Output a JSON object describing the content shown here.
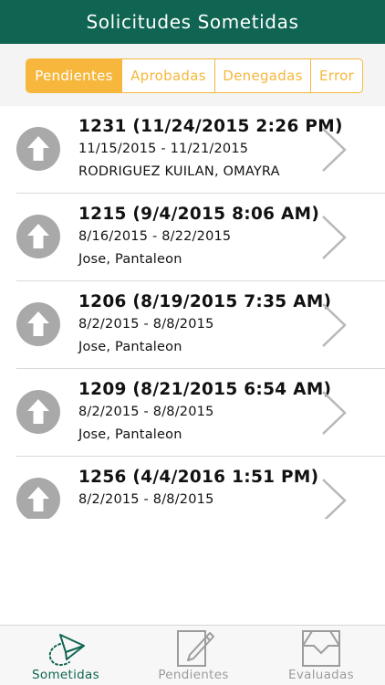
{
  "header": {
    "title": "Solicitudes Sometidas"
  },
  "segments": [
    {
      "label": "Pendientes",
      "active": true
    },
    {
      "label": "Aprobadas",
      "active": false
    },
    {
      "label": "Denegadas",
      "active": false
    },
    {
      "label": "Error",
      "active": false
    }
  ],
  "requests": [
    {
      "title": "1231 (11/24/2015 2:26 PM)",
      "range": "11/15/2015 - 11/21/2015",
      "name": "RODRIGUEZ KUILAN, OMAYRA",
      "icon": "arrow-up-icon"
    },
    {
      "title": "1215 (9/4/2015 8:06 AM)",
      "range": "8/16/2015 - 8/22/2015",
      "name": "Jose, Pantaleon",
      "icon": "arrow-up-icon"
    },
    {
      "title": "1206 (8/19/2015 7:35 AM)",
      "range": "8/2/2015 - 8/8/2015",
      "name": "Jose, Pantaleon",
      "icon": "arrow-up-icon"
    },
    {
      "title": "1209 (8/21/2015 6:54 AM)",
      "range": "8/2/2015 - 8/8/2015",
      "name": "Jose, Pantaleon",
      "icon": "arrow-up-icon"
    },
    {
      "title": "1256 (4/4/2016 1:51 PM)",
      "range": "8/2/2015 - 8/8/2015",
      "name": "",
      "icon": "arrow-up-icon"
    }
  ],
  "tabbar": [
    {
      "label": "Sometidas",
      "icon": "paper-plane-icon",
      "active": true
    },
    {
      "label": "Pendientes",
      "icon": "pencil-paper-icon",
      "active": false
    },
    {
      "label": "Evaluadas",
      "icon": "tray-icon",
      "active": false
    }
  ],
  "colors": {
    "header": "#0f6552",
    "accent": "#f6b73c",
    "icon_gray": "#a9a9a9",
    "tab_active": "#0f6552",
    "tab_inactive": "#9c9c9c"
  }
}
